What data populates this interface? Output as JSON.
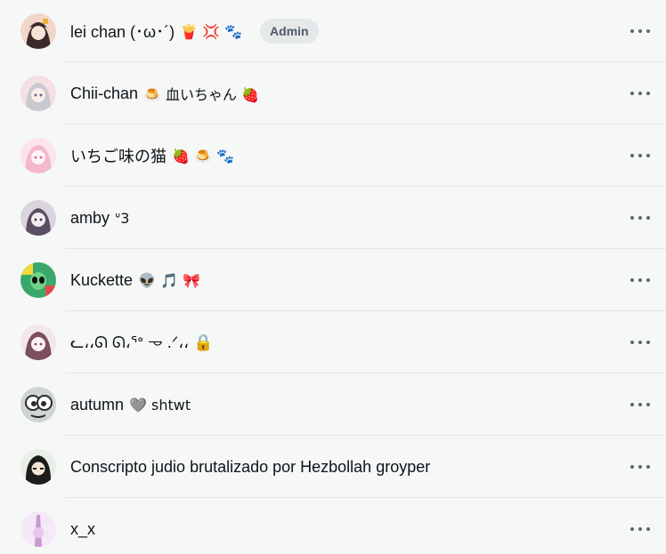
{
  "members": [
    {
      "name": "lei chan (･ω･´)",
      "decor": "🍟 💢 🐾",
      "badge": "Admin",
      "avatar": {
        "bg": "#f2d7c9",
        "fg": "#3a2a2a",
        "icon": "avatar-anime-girl-icon"
      }
    },
    {
      "name": "Chii-chan",
      "decor": "🍮 血いちゃん 🍓",
      "badge": "",
      "avatar": {
        "bg": "#f4dfe3",
        "fg": "#c9c9d0",
        "icon": "avatar-anime-girl-icon"
      }
    },
    {
      "name": "いちご味の猫",
      "decor": "🍓 🍮 🐾",
      "badge": "",
      "avatar": {
        "bg": "#fbe4ee",
        "fg": "#f3b7cf",
        "icon": "avatar-anime-girl-icon"
      }
    },
    {
      "name": "amby",
      "decor": "ᐡ3",
      "badge": "",
      "avatar": {
        "bg": "#d9d4de",
        "fg": "#5a4f63",
        "icon": "avatar-anime-girl-icon"
      }
    },
    {
      "name": "Kuckette",
      "decor": "👽 🎵 🎀",
      "badge": "",
      "avatar": {
        "bg": "#3aa86b",
        "fg": "#f0d93a",
        "icon": "avatar-alien-icon"
      }
    },
    {
      "name": "ᓚ،،ᘏ ᘏ،ᕐᐤ 𐃷 .ᐟ،، 🔒",
      "decor": "",
      "badge": "",
      "avatar": {
        "bg": "#f3e6ec",
        "fg": "#7b4f5e",
        "icon": "avatar-anime-girl-icon"
      }
    },
    {
      "name": "autumn",
      "decor": "🩶 shtwt",
      "badge": "",
      "avatar": {
        "bg": "#cfd4d4",
        "fg": "#2c2c2c",
        "icon": "avatar-cartoon-icon"
      }
    },
    {
      "name": "Conscripto judio brutalizado por Hezbollah groyper",
      "decor": "",
      "badge": "",
      "avatar": {
        "bg": "#e9efe6",
        "fg": "#1c1c1c",
        "icon": "avatar-anime-girl-icon"
      }
    },
    {
      "name": "x_x",
      "decor": "",
      "badge": "",
      "avatar": {
        "bg": "#f5e8f7",
        "fg": "#c59ad0",
        "icon": "avatar-anime-girl-icon"
      }
    }
  ],
  "more_label": "More options"
}
